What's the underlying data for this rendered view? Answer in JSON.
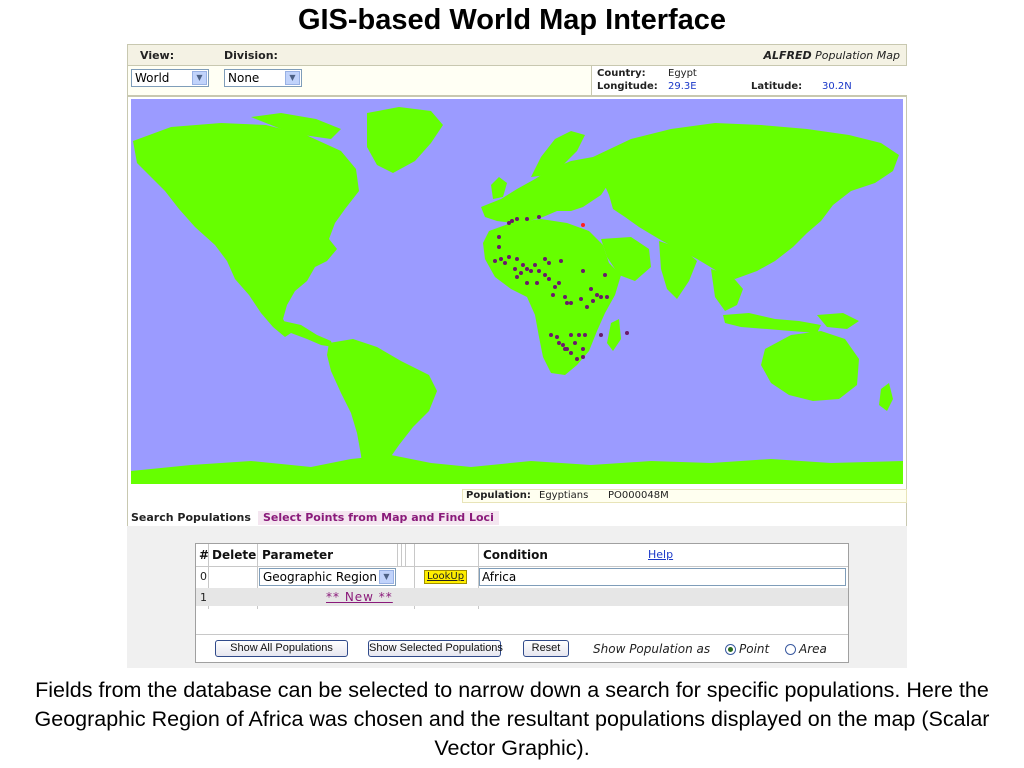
{
  "slide": {
    "title": "GIS-based World Map Interface",
    "caption": "Fields from the database can be selected to narrow down a search for specific populations. Here the Geographic Region of Africa was chosen and the resultant populations displayed on the map (Scalar Vector Graphic)."
  },
  "app": {
    "view_label": "View:",
    "division_label": "Division:",
    "brand_bold": "ALFRED",
    "brand_rest": "Population Map",
    "view_select": "World",
    "division_select": "None",
    "country_label": "Country:",
    "country_value": "Egypt",
    "longitude_label": "Longitude:",
    "longitude_value": "29.3E",
    "latitude_label": "Latitude:",
    "latitude_value": "30.2N"
  },
  "map": {
    "ocean_color": "#9b9bff",
    "land_color": "#66ff00",
    "point_color": "#6b1a6b",
    "selected_point_color": "#ff2020"
  },
  "population_bar": {
    "label": "Population:",
    "name": "Egyptians",
    "id": "PO000048M"
  },
  "tabs": {
    "search": "Search Populations",
    "select": "Select Points from Map and Find Loci"
  },
  "grid": {
    "headers": {
      "num": "#",
      "delete": "Delete",
      "parameter": "Parameter",
      "condition": "Condition",
      "help": "Help"
    },
    "rows": [
      {
        "num": "0",
        "parameter": "Geographic Region",
        "lookup": "LookUp",
        "condition": "Africa"
      },
      {
        "num": "1",
        "new_link": "** New **"
      }
    ]
  },
  "buttons": {
    "show_all": "Show All Populations",
    "show_selected": "Show Selected Populations",
    "reset": "Reset"
  },
  "display_mode": {
    "label": "Show Population as",
    "options": [
      "Point",
      "Area"
    ],
    "selected": "Point"
  }
}
